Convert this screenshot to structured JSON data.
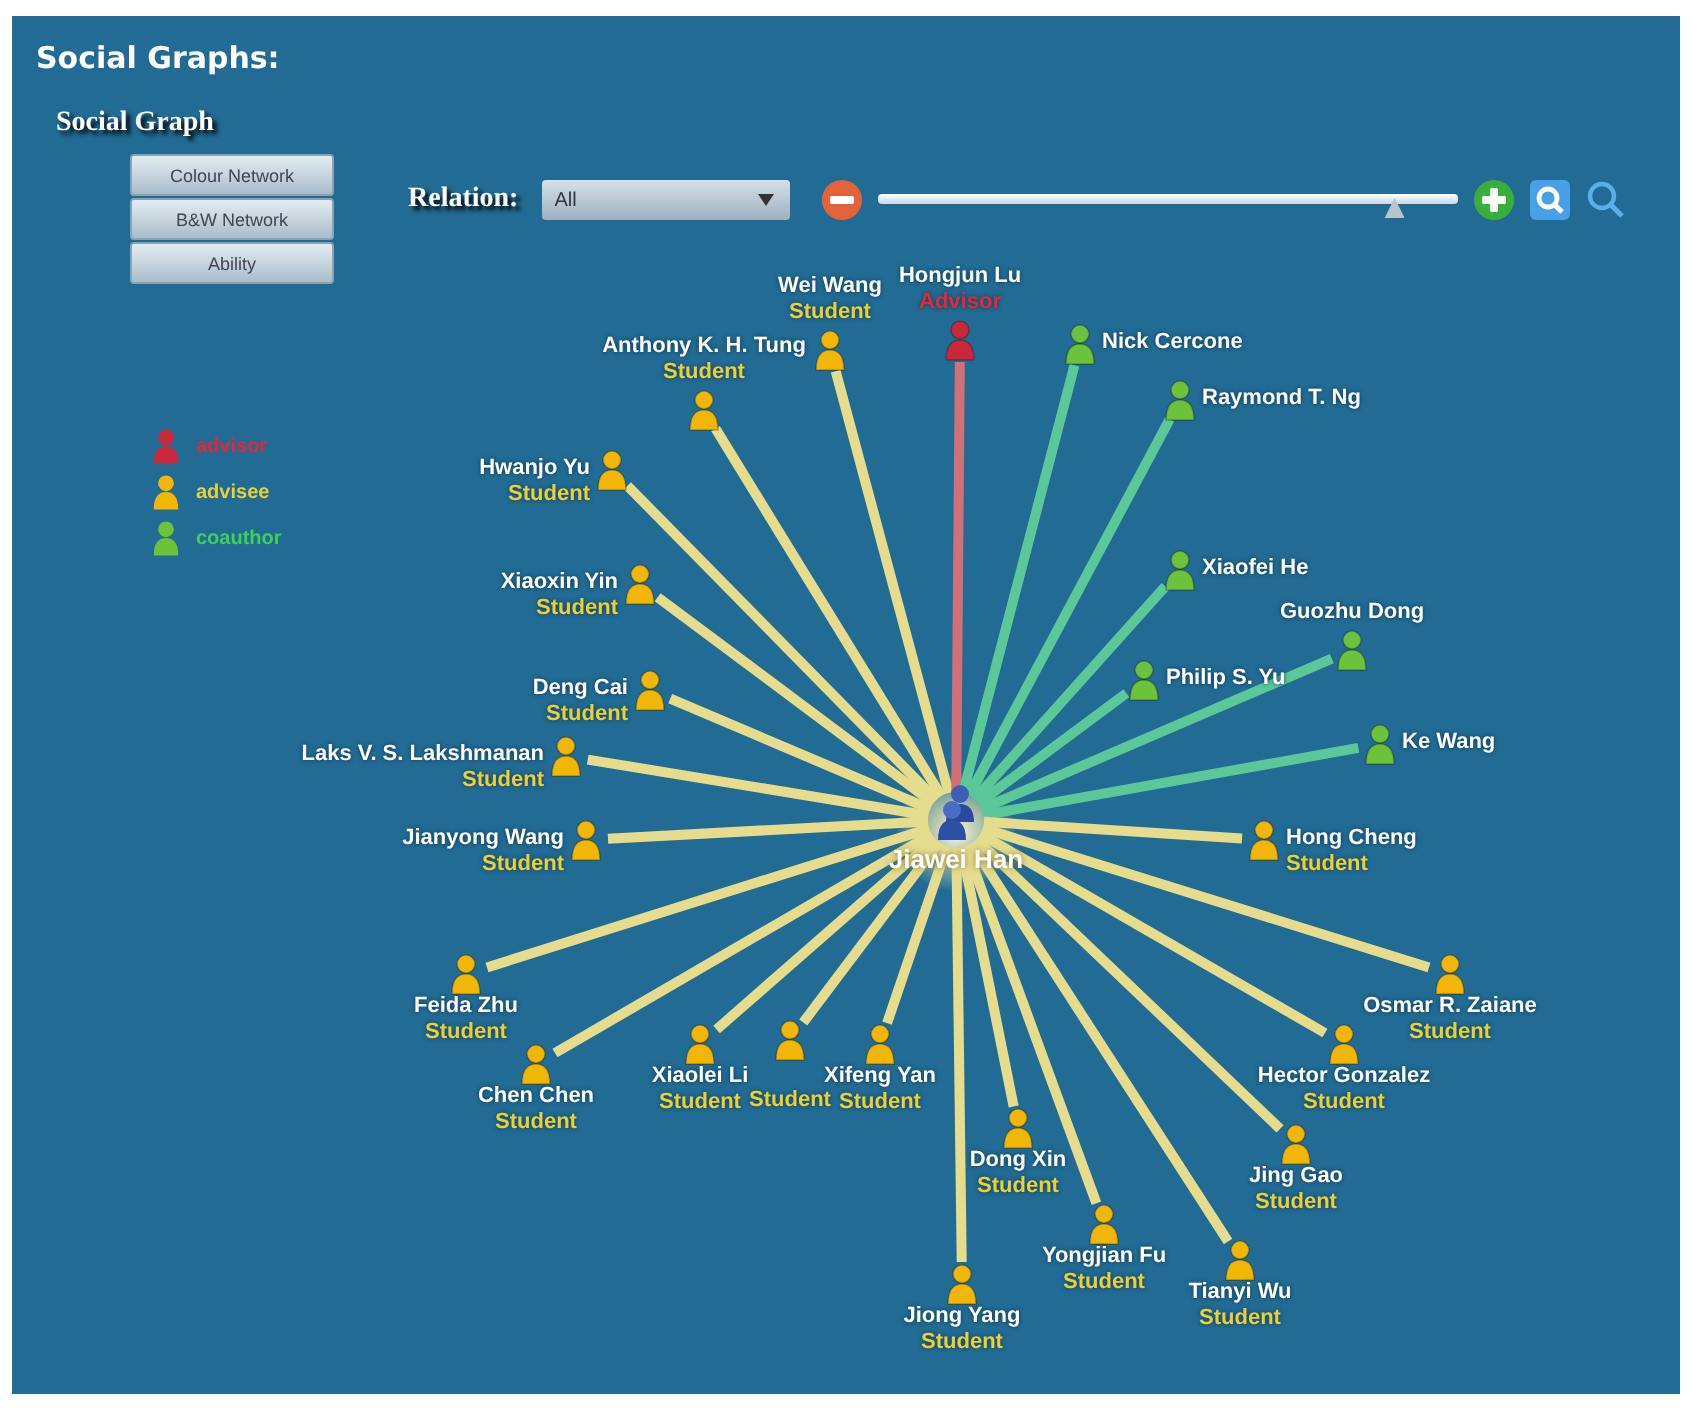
{
  "title": "Social Graphs:",
  "panel_title": "Social Graph",
  "view_buttons": [
    "Colour Network",
    "B&W Network",
    "Ability"
  ],
  "relation": {
    "label": "Relation:",
    "value": "All"
  },
  "zoom": {
    "level": 0.89
  },
  "legend": [
    {
      "kind": "advisor",
      "label": "advisor"
    },
    {
      "kind": "advisee",
      "label": "advisee"
    },
    {
      "kind": "coauthor",
      "label": "coauthor"
    }
  ],
  "graph": {
    "center": {
      "name": "Jiawei Han"
    },
    "nodes": [
      {
        "kind": "advisee",
        "name": "Wei Wang",
        "role": "Student"
      },
      {
        "kind": "advisor",
        "name": "Hongjun Lu",
        "role": "Advisor"
      },
      {
        "kind": "coauthor",
        "name": "Nick Cercone"
      },
      {
        "kind": "advisee",
        "name": "Anthony K. H. Tung",
        "role": "Student"
      },
      {
        "kind": "advisee",
        "name": "Hwanjo Yu",
        "role": "Student"
      },
      {
        "kind": "coauthor",
        "name": "Raymond T. Ng"
      },
      {
        "kind": "coauthor",
        "name": "Xiaofei He"
      },
      {
        "kind": "advisee",
        "name": "Xiaoxin Yin",
        "role": "Student"
      },
      {
        "kind": "coauthor",
        "name": "Philip S. Yu"
      },
      {
        "kind": "coauthor",
        "name": "Guozhu Dong"
      },
      {
        "kind": "advisee",
        "name": "Deng Cai",
        "role": "Student"
      },
      {
        "kind": "advisee",
        "name": "Laks V. S. Lakshmanan",
        "role": "Student"
      },
      {
        "kind": "coauthor",
        "name": "Ke Wang"
      },
      {
        "kind": "advisee",
        "name": "Jianyong Wang",
        "role": "Student"
      },
      {
        "kind": "advisee",
        "name": "Hong Cheng",
        "role": "Student"
      },
      {
        "kind": "advisee",
        "name": "Feida Zhu",
        "role": "Student"
      },
      {
        "kind": "advisee",
        "name": "Osmar R. Zaiane",
        "role": "Student"
      },
      {
        "kind": "advisee",
        "name": "Chen Chen",
        "role": "Student"
      },
      {
        "kind": "advisee",
        "name": "Xiaolei Li",
        "role": "Student"
      },
      {
        "kind": "advisee",
        "role": "Student"
      },
      {
        "kind": "advisee",
        "name": "Xifeng Yan",
        "role": "Student"
      },
      {
        "kind": "advisee",
        "name": "Dong Xin",
        "role": "Student"
      },
      {
        "kind": "advisee",
        "name": "Hector Gonzalez",
        "role": "Student"
      },
      {
        "kind": "advisee",
        "name": "Jing Gao",
        "role": "Student"
      },
      {
        "kind": "advisee",
        "name": "Yongjian Fu",
        "role": "Student"
      },
      {
        "kind": "advisee",
        "name": "Tianyi Wu",
        "role": "Student"
      },
      {
        "kind": "advisee",
        "name": "Jiong Yang",
        "role": "Student"
      }
    ]
  }
}
